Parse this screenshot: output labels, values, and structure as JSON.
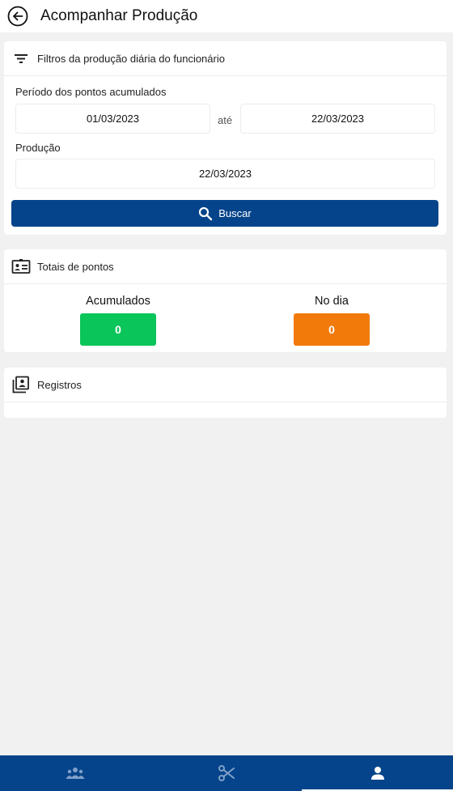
{
  "header": {
    "title": "Acompanhar Produção",
    "back_icon": "arrow-left-circle-icon"
  },
  "filters": {
    "title": "Filtros da produção diária do funcionário",
    "period_label": "Período dos pontos acumulados",
    "date_from": "01/03/2023",
    "separator": "até",
    "date_to": "22/03/2023",
    "production_label": "Produção",
    "production_date": "22/03/2023",
    "search_label": "Buscar"
  },
  "totals": {
    "title": "Totais de pontos",
    "accumulated_label": "Acumulados",
    "accumulated_value": "0",
    "accumulated_color": "#0ac55a",
    "day_label": "No dia",
    "day_value": "0",
    "day_color": "#f27a0a"
  },
  "records": {
    "title": "Registros"
  },
  "bottom_nav": {
    "items": [
      {
        "icon": "people-group-icon"
      },
      {
        "icon": "scissors-icon"
      },
      {
        "icon": "person-icon",
        "active": true
      }
    ]
  },
  "colors": {
    "primary": "#05448a",
    "background": "#f1f1f1"
  }
}
